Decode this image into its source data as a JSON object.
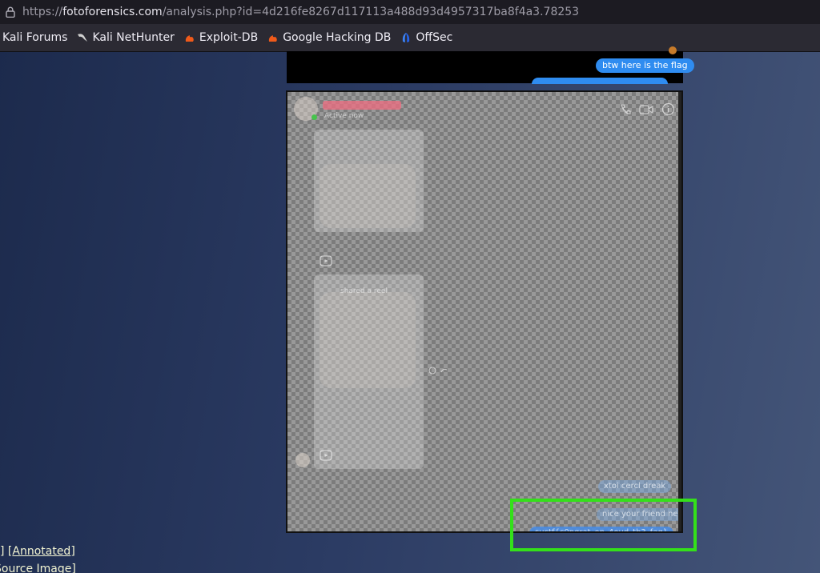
{
  "browser": {
    "url_scheme": "https://",
    "url_host": "fotoforensics.com",
    "url_path": "/analysis.php?id=4d216fe8267d117113a488d93d4957317ba8f4a3.78253"
  },
  "bookmarks": [
    {
      "label": "Kali Forums",
      "icon": "kali-forums-icon",
      "color": "#3b82f6"
    },
    {
      "label": "Kali NetHunter",
      "icon": "nethunter-icon",
      "color": "#d0d0d0"
    },
    {
      "label": "Exploit-DB",
      "icon": "exploit-db-icon",
      "color": "#f05a1a"
    },
    {
      "label": "Google Hacking DB",
      "icon": "ghdb-icon",
      "color": "#f05a1a"
    },
    {
      "label": "OffSec",
      "icon": "offsec-icon",
      "color": "#3b82f6"
    }
  ],
  "chat_top": {
    "flag_message": "btw here is the flag"
  },
  "analysis": {
    "status_text": "Active now",
    "shared_label": "shared a reel",
    "bubble_1": "xtoi cercl dreak",
    "bubble_2": "nice your friend ne",
    "bubble_3": "suctf{c0ngrat_on_4oud_th3_fag}"
  },
  "footer": {
    "annotated_prefix": "] [",
    "annotated_label": "Annotated",
    "annotated_suffix": "]",
    "source_label": "Source Image",
    "source_suffix": "]"
  },
  "colors": {
    "highlight": "#34e01a",
    "bubble_blue": "#2f8cf0"
  }
}
